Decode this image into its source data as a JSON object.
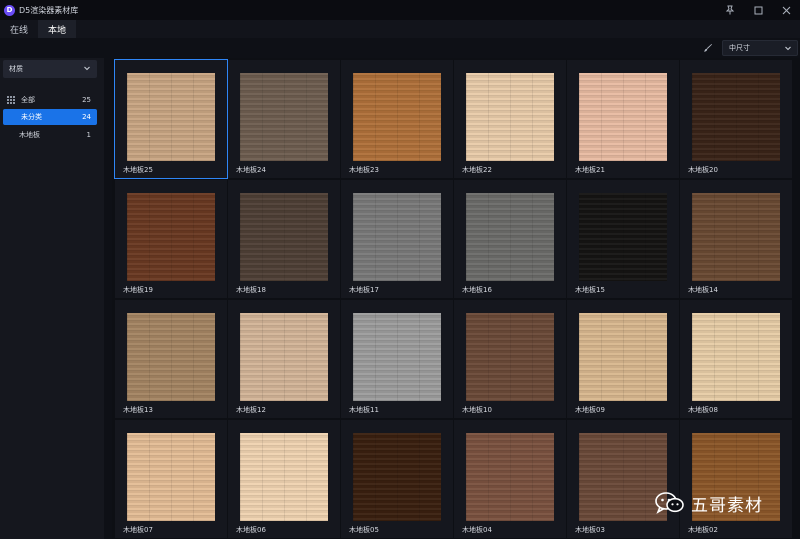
{
  "window": {
    "app_logo_text": "D",
    "title": "D5渲染器素材库",
    "controls": [
      "pin-icon",
      "maximize-icon",
      "close-icon"
    ]
  },
  "tabs": [
    {
      "label": "在线",
      "active": false
    },
    {
      "label": "本地",
      "active": true
    }
  ],
  "toolbar": {
    "brush_icon": "paintbrush-icon",
    "size_select_value": "中尺寸"
  },
  "sidebar": {
    "category_select_value": "材质",
    "tree": [
      {
        "label": "全部",
        "count": "25",
        "icon": "grid-icon",
        "selected": false
      },
      {
        "label": "未分类",
        "count": "24",
        "selected": true
      },
      {
        "label": "木地板",
        "count": "1",
        "selected": false
      }
    ]
  },
  "materials": [
    {
      "label": "木地板25",
      "selected": true,
      "color": "#c9a683"
    },
    {
      "label": "木地板24",
      "color": "#6e5e50"
    },
    {
      "label": "木地板23",
      "color": "#b0713a"
    },
    {
      "label": "木地板22",
      "color": "#e9ccaa"
    },
    {
      "label": "木地板21",
      "color": "#e8bba2"
    },
    {
      "label": "木地板20",
      "color": "#3a2418"
    },
    {
      "label": "木地板19",
      "color": "#6a3922"
    },
    {
      "label": "木地板18",
      "color": "#4f4036"
    },
    {
      "label": "木地板17",
      "color": "#7a7a7a"
    },
    {
      "label": "木地板16",
      "color": "#6c6c6a"
    },
    {
      "label": "木地板15",
      "color": "#151413"
    },
    {
      "label": "木地板14",
      "color": "#6a4a33"
    },
    {
      "label": "木地板13",
      "color": "#a58563"
    },
    {
      "label": "木地板12",
      "color": "#d3b598"
    },
    {
      "label": "木地板11",
      "color": "#9d9d9d"
    },
    {
      "label": "木地板10",
      "color": "#6b4a38"
    },
    {
      "label": "木地板09",
      "color": "#d9b88f"
    },
    {
      "label": "木地板08",
      "color": "#e7cda7"
    },
    {
      "label": "木地板07",
      "color": "#e4bd96"
    },
    {
      "label": "木地板06",
      "color": "#f0d3b1"
    },
    {
      "label": "木地板05",
      "color": "#3a2010"
    },
    {
      "label": "木地板04",
      "color": "#7b5240"
    },
    {
      "label": "木地板03",
      "color": "#6b4a39"
    },
    {
      "label": "木地板02",
      "color": "#8c5729"
    }
  ],
  "watermark": {
    "icon": "wechat-icon",
    "text": "五哥素材"
  }
}
